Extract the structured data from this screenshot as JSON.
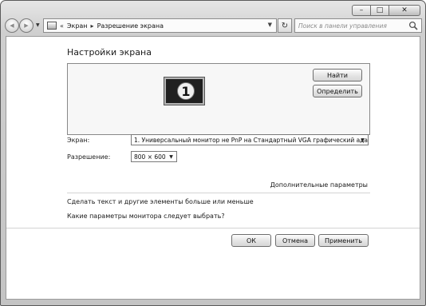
{
  "window": {
    "caption": {
      "minimize": "–",
      "maximize": "□",
      "close": "✕"
    }
  },
  "nav": {
    "back": "◀",
    "forward": "▶",
    "dropdown": "▼"
  },
  "address": {
    "prefix": "«",
    "crumbs": [
      "Экран",
      "Разрешение экрана"
    ],
    "separator": "▸",
    "dropdown": "▼",
    "refresh": "↻"
  },
  "search": {
    "placeholder": "Поиск в панели управления"
  },
  "page": {
    "title": "Настройки экрана",
    "monitor_number": "1",
    "detect_button": "Найти",
    "identify_button": "Определить",
    "display_label": "Экран:",
    "display_value": "1. Универсальный монитор не PnP на Стандартный VGA графический адапт",
    "resolution_label": "Разрешение:",
    "resolution_value": "800 × 600",
    "advanced_link": "Дополнительные параметры",
    "link_text_size": "Сделать текст и другие элементы больше или меньше",
    "link_which_settings": "Какие параметры монитора следует выбрать?"
  },
  "footer": {
    "ok": "ОК",
    "cancel": "Отмена",
    "apply": "Применить"
  },
  "colors": {
    "window_frame": "#cfcfcf",
    "content_bg": "#ffffff",
    "monitor_screen": "#202020"
  },
  "icons": [
    "back-arrow-icon",
    "forward-arrow-icon",
    "display-folder-icon",
    "refresh-icon",
    "search-icon",
    "dropdown-caret-icon"
  ]
}
